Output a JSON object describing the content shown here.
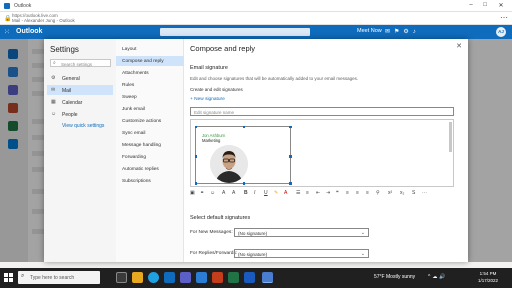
{
  "browser": {
    "window_title": "Outlook",
    "url": "https://outlook.live.com",
    "url_subtitle": "Mail - Alexander Jung - Outlook"
  },
  "app": {
    "name": "Outlook",
    "meet_now": "Meet Now",
    "avatar_initials": "AJ",
    "accent": "#0f6cbd"
  },
  "settings": {
    "heading": "Settings",
    "search_placeholder": "Search settings",
    "categories": [
      {
        "label": "General",
        "icon": "gear-icon"
      },
      {
        "label": "Mail",
        "icon": "mail-icon",
        "selected": true
      },
      {
        "label": "Calendar",
        "icon": "calendar-icon"
      },
      {
        "label": "People",
        "icon": "people-icon"
      }
    ],
    "quick_settings": "View quick settings",
    "subcategories": [
      "Layout",
      "Compose and reply",
      "Attachments",
      "Rules",
      "Sweep",
      "Junk email",
      "Customize actions",
      "Sync email",
      "Message handling",
      "Forwarding",
      "Automatic replies",
      "Subscriptions"
    ],
    "selected_subcategory": "Compose and reply"
  },
  "pane": {
    "title": "Compose and reply",
    "email_signature": "Email signature",
    "signature_desc": "Edit and choose signatures that will be automatically added to your email messages.",
    "create_edit": "Create and edit signatures",
    "new_signature": "New signature",
    "sig_name_placeholder": "Edit signature name",
    "sig_person_name": "Jon Ashburn",
    "sig_person_role": "Marketing",
    "select_default": "Select default signatures",
    "for_new_messages": "For New Messages:",
    "for_new_value": "(No signature)",
    "for_replies": "For Replies/Forwards:",
    "for_replies_value": "(No signature)"
  },
  "taskbar": {
    "search_placeholder": "Type here to search",
    "weather": "57°F  Mostly sunny",
    "time": "1:54 PM",
    "date": "1/17/2022"
  }
}
